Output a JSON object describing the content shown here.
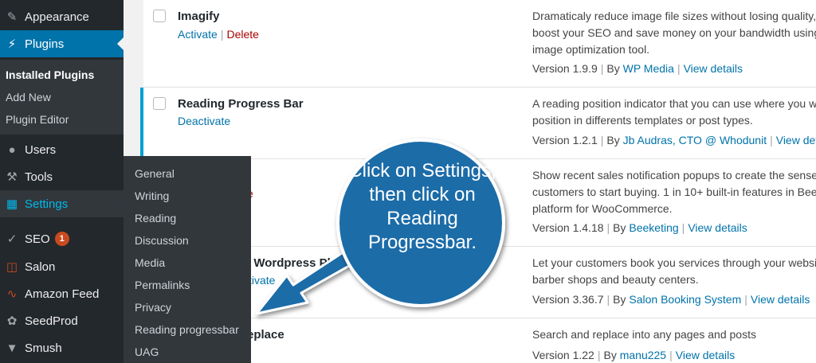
{
  "sidebar": {
    "items": [
      {
        "label": "Appearance",
        "icon": "paintbrush-icon"
      },
      {
        "label": "Plugins",
        "icon": "plugin-icon"
      },
      {
        "label": "Users",
        "icon": "users-icon"
      },
      {
        "label": "Tools",
        "icon": "wrench-icon"
      },
      {
        "label": "Settings",
        "icon": "settings-icon"
      },
      {
        "label": "SEO",
        "icon": "yoast-icon",
        "badge": "1"
      },
      {
        "label": "Salon",
        "icon": "calendar-icon"
      },
      {
        "label": "Amazon Feed",
        "icon": "rss-icon"
      },
      {
        "label": "SeedProd",
        "icon": "seed-icon"
      },
      {
        "label": "Smush",
        "icon": "smush-icon"
      }
    ],
    "plugins_submenu": [
      "Installed Plugins",
      "Add New",
      "Plugin Editor"
    ]
  },
  "settings_flyout": [
    "General",
    "Writing",
    "Reading",
    "Discussion",
    "Media",
    "Permalinks",
    "Privacy",
    "Reading progressbar",
    "UAG"
  ],
  "plugins": [
    {
      "name": "Imagify",
      "action1": "Activate",
      "action2": "Delete",
      "desc": [
        "Dramaticaly reduce image file sizes without losing quality,",
        "boost your SEO and save money on your bandwidth using",
        "image optimization tool."
      ],
      "version": "Version 1.9.9",
      "by": "By",
      "author": "WP Media",
      "details": "View details"
    },
    {
      "name": "Reading Progress Bar",
      "action1": "Deactivate",
      "desc": [
        "A reading position indicator that you can use where you wa",
        "position in differents templates or post types."
      ],
      "version": "Version 1.2.1",
      "by": "By",
      "author": "Jb Audras, CTO @ Whodunit",
      "details": "View details"
    },
    {
      "action2": "e",
      "desc": [
        "Show recent sales notification popups to create the sense",
        "customers to start buying. 1 in 10+ built-in features in Beek",
        "platform for WooCommerce."
      ],
      "version": "Version 1.4.18",
      "by": "By",
      "author": "Beeketing",
      "details": "View details"
    },
    {
      "name": "g Wordpress Pl",
      "action1": "ctivate",
      "desc": [
        "Let your customers book you services through your websit",
        "barber shops and beauty centers."
      ],
      "version": "Version 3.36.7",
      "by": "By",
      "author": "Salon Booking System",
      "details": "View details"
    },
    {
      "name": "eplace",
      "desc": [
        "Search and replace into any pages and posts"
      ],
      "version": "Version 1.22",
      "by": "By",
      "author": "manu225",
      "details": "View details"
    }
  ],
  "callout": {
    "text": "Click on Settings, then click on Reading Progressbar.",
    "color": "#1b6ca8",
    "border": "#ffffff"
  },
  "colors": {
    "sidebar": "#23282d",
    "accent": "#0073aa",
    "settings_text": "#00b9eb",
    "badge": "#ca4a1f"
  }
}
